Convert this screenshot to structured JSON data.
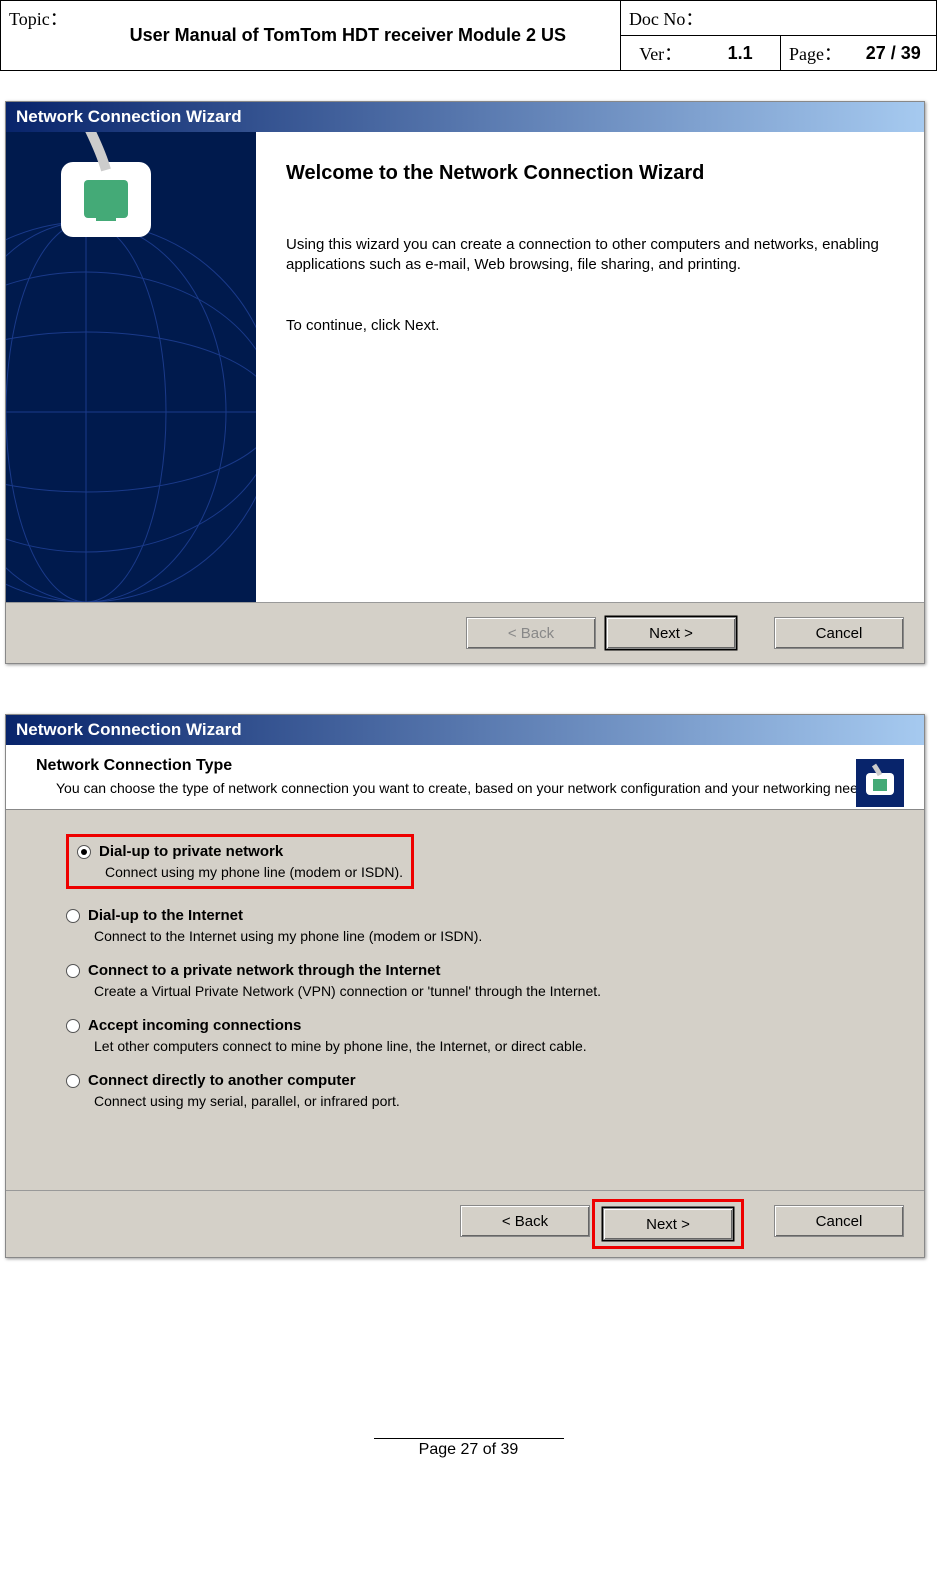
{
  "header": {
    "topic_label": "Topic：",
    "title": "User Manual of TomTom HDT receiver  Module 2 US",
    "doc_no_label": "Doc No：",
    "doc_no_value": "",
    "ver_label": "Ver：",
    "ver_value": "1.1",
    "page_label": "Page：",
    "page_value": "27 / 39"
  },
  "wizard1": {
    "titlebar": "Network Connection Wizard",
    "heading": "Welcome to the Network Connection Wizard",
    "p1": "Using this wizard you can create a connection to other computers and networks, enabling applications such as e-mail, Web browsing, file sharing, and printing.",
    "p2": "To continue, click Next.",
    "buttons": {
      "back": "< Back",
      "next": "Next >",
      "cancel": "Cancel"
    }
  },
  "wizard2": {
    "titlebar": "Network Connection Wizard",
    "header_title": "Network Connection Type",
    "header_sub": "You can choose the type of network connection you want to create, based on your network configuration and your networking needs.",
    "options": [
      {
        "title": "Dial-up to private network",
        "desc": "Connect using my phone line (modem or ISDN).",
        "selected": true,
        "highlight": true
      },
      {
        "title": "Dial-up to the Internet",
        "desc": "Connect to the Internet using my phone line (modem or ISDN)."
      },
      {
        "title": "Connect to a private network through the Internet",
        "desc": "Create a Virtual Private Network (VPN) connection or 'tunnel' through the Internet."
      },
      {
        "title": "Accept incoming connections",
        "desc": "Let other computers connect to mine by phone line, the Internet, or direct cable."
      },
      {
        "title": "Connect directly to another computer",
        "desc": "Connect using my serial, parallel, or infrared port."
      }
    ],
    "buttons": {
      "back": "< Back",
      "next": "Next >",
      "cancel": "Cancel"
    }
  },
  "footer": {
    "text": "Page 27 of 39"
  }
}
